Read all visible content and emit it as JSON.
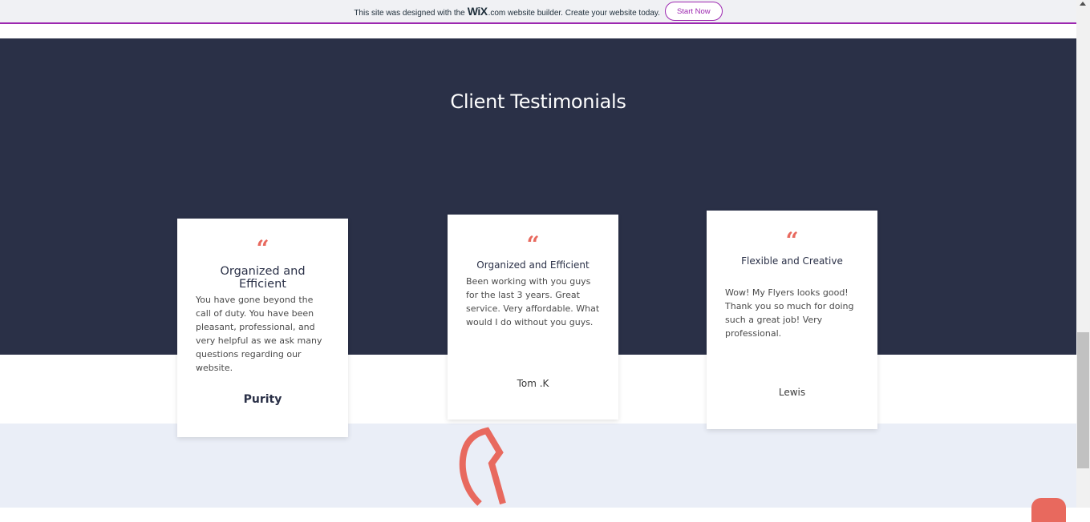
{
  "banner": {
    "prefix": "This site was designed with the",
    "logo": "WiX",
    "suffix": ".com website builder. Create your website today.",
    "button_label": "Start Now"
  },
  "section": {
    "title": "Client Testimonials"
  },
  "testimonials": [
    {
      "quote_glyph": "“",
      "title": "Organized and Efficient",
      "body": "You have gone beyond the call of duty. You have been pleasant, professional, and very helpful as we ask many questions regarding our website.",
      "author": "Purity"
    },
    {
      "quote_glyph": "“",
      "title": "Organized and Efficient",
      "body": "Been working with you guys for the last 3 years. Great service. Very affordable. What would I do without you guys.",
      "author": "Tom .K"
    },
    {
      "quote_glyph": "“",
      "title": "Flexible and Creative",
      "body": "Wow! My Flyers looks good! Thank you so much for doing such a great job! Very professional.",
      "author": "Lewis"
    }
  ],
  "colors": {
    "dark_bg": "#2a3047",
    "accent": "#e8695e",
    "banner_accent": "#9c27b0",
    "light_bg": "#eaeef7"
  },
  "icons": {
    "quote": "quote-icon",
    "chat": "chat-icon"
  }
}
